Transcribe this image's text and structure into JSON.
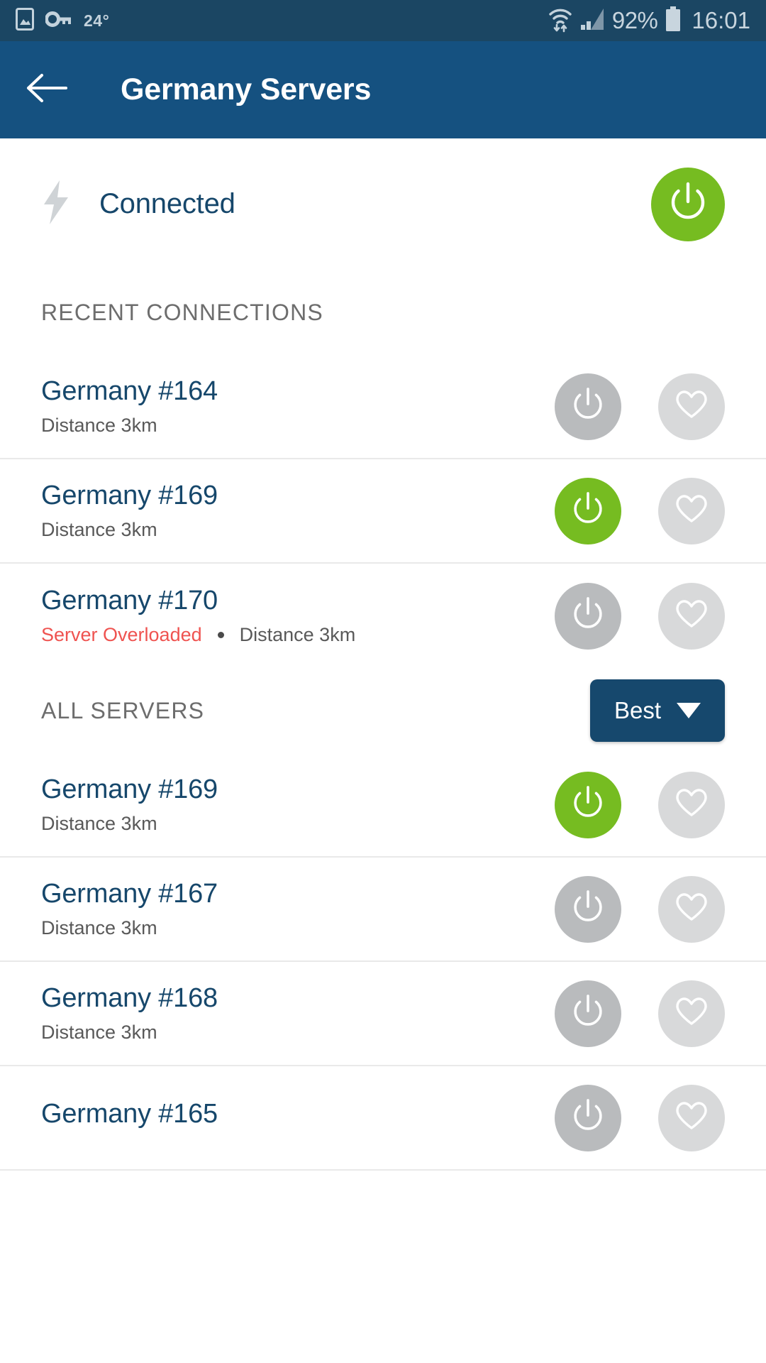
{
  "status_bar": {
    "image_icon": "image-icon",
    "vpn_key_icon": "vpn-key-icon",
    "temperature": "24°",
    "wifi_icon": "wifi-icon",
    "signal_icon": "cellular-signal-icon",
    "battery_percent": "92%",
    "battery_icon": "battery-icon",
    "clock": "16:01"
  },
  "app_bar": {
    "back_icon": "back-arrow-icon",
    "title": "Germany Servers"
  },
  "connection": {
    "bolt_icon": "lightning-bolt-icon",
    "status_text": "Connected",
    "power_icon": "power-icon"
  },
  "sections": {
    "recent_label": "RECENT CONNECTIONS",
    "all_label": "ALL SERVERS",
    "sort": {
      "value": "Best",
      "caret_icon": "chevron-down-icon"
    }
  },
  "colors": {
    "status_bar_bg": "#1b4663",
    "app_bar_bg": "#155180",
    "accent_green": "#76bc21",
    "brand_blue": "#16476b",
    "warning_red": "#ef5350",
    "power_off_gray": "#b9bbbd",
    "fav_gray": "#d8d9da"
  },
  "recent_connections": [
    {
      "name": "Germany #164",
      "warning": "",
      "distance": "Distance 3km",
      "connected": false
    },
    {
      "name": "Germany #169",
      "warning": "",
      "distance": "Distance 3km",
      "connected": true
    },
    {
      "name": "Germany #170",
      "warning": "Server Overloaded",
      "distance": "Distance 3km",
      "connected": false
    }
  ],
  "all_servers": [
    {
      "name": "Germany #169",
      "warning": "",
      "distance": "Distance 3km",
      "connected": true
    },
    {
      "name": "Germany #167",
      "warning": "",
      "distance": "Distance 3km",
      "connected": false
    },
    {
      "name": "Germany #168",
      "warning": "",
      "distance": "Distance 3km",
      "connected": false
    },
    {
      "name": "Germany #165",
      "warning": "",
      "distance": "",
      "connected": false
    }
  ]
}
